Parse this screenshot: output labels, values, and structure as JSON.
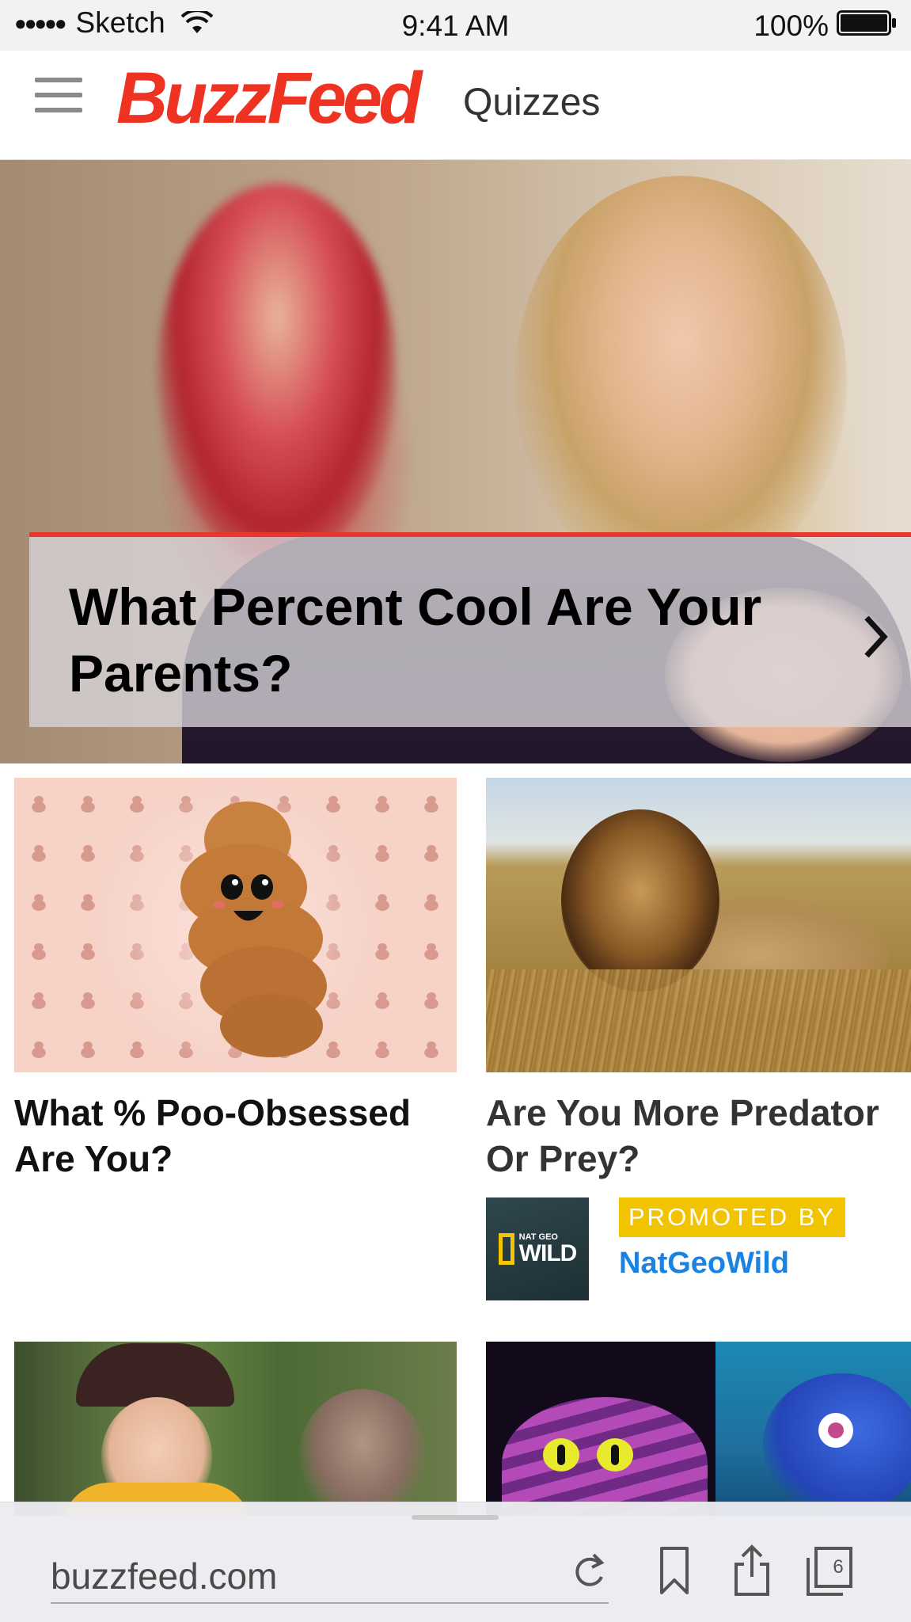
{
  "status_bar": {
    "signal": "●●●●●",
    "carrier": "Sketch",
    "time": "9:41 AM",
    "battery_percent": "100%",
    "battery_level": 1.0
  },
  "header": {
    "logo_text": "BuzzFeed",
    "section": "Quizzes",
    "menu_icon": "hamburger-menu-icon",
    "brand_color": "#ee3322"
  },
  "hero": {
    "title": "What Percent Cool Are Your Parents?",
    "action_icon": "chevron-right-icon",
    "accent_color": "#e8382d"
  },
  "cards": [
    {
      "title": "What % Poo-Obsessed Are You?"
    },
    {
      "title": "Are You More Predator Or Prey?",
      "promo": {
        "badge": "PROMOTED BY",
        "brand": "NatGeoWild",
        "logo_small": "NAT GEO",
        "logo_big": "WILD",
        "badge_color": "#f2c400",
        "brand_color": "#1a82e2"
      }
    }
  ],
  "browser": {
    "url": "buzzfeed.com",
    "tab_count": "6",
    "icons": [
      "reload-icon",
      "bookmark-icon",
      "share-icon",
      "tabs-icon"
    ]
  }
}
